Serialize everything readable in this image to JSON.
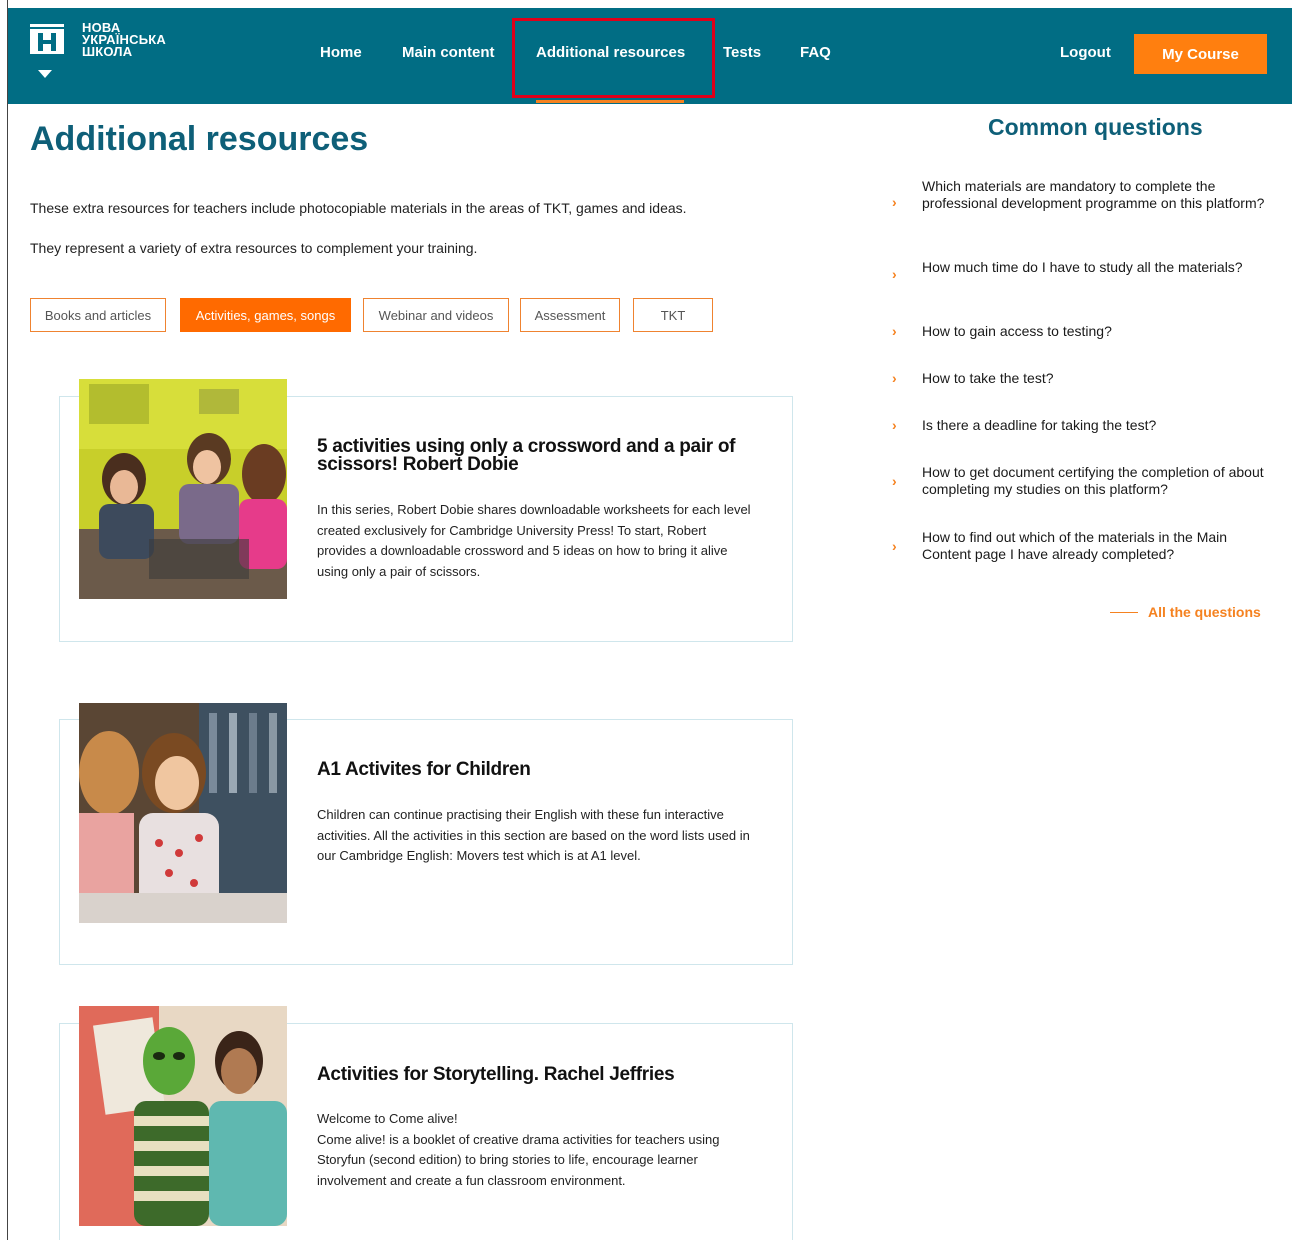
{
  "header": {
    "logo_lines": [
      "НОВА",
      "УКРАЇНСЬКА",
      "ШКОЛА"
    ],
    "nav": [
      "Home",
      "Main content",
      "Additional resources",
      "Tests",
      "FAQ"
    ],
    "active_nav": "Additional resources",
    "logout_label": "Logout",
    "my_course_label": "My Course"
  },
  "main": {
    "title": "Additional resources",
    "intro": [
      "These extra resources for teachers include photocopiable materials in the areas of TKT, games and ideas.",
      "They represent a variety of extra resources to complement your training."
    ],
    "filters": [
      "Books and articles",
      "Activities, games, songs",
      "Webinar and videos",
      "Assessment",
      "TKT"
    ],
    "active_filter": "Activities, games, songs",
    "cards": [
      {
        "title": "5 activities using only a crossword and a pair of scissors! Robert Dobie",
        "description": "In this series, Robert Dobie shares downloadable worksheets for each level created exclusively for Cambridge University Press! To start, Robert provides a downloadable crossword and 5 ideas on how to bring it alive using only a pair of scissors."
      },
      {
        "title": "A1 Activites for Children",
        "description": "Children can continue practising their English with these fun interactive activities. All the activities in this section are based on the word lists used in our Cambridge English: Movers test which is at A1 level."
      },
      {
        "title": "Activities for Storytelling. Rachel Jeffries",
        "description_lines": [
          "Welcome to Come alive!",
          "Come alive! is a booklet of creative drama activities for teachers using Storyfun (second edition) to bring stories to life, encourage learner involvement and create a fun classroom environment."
        ]
      }
    ]
  },
  "sidebar": {
    "title": "Common questions",
    "questions": [
      "Which materials are mandatory to complete the professional development programme on this platform?",
      "How much time do I have to study all the materials?",
      "How to gain access to testing?",
      "How to take the test?",
      "Is there a deadline for taking the test?",
      "How to get document certifying the completion of about completing my studies on this platform?",
      "How to find out which of the materials in the Main Content page I have already completed?"
    ],
    "all_questions_label": "All the questions"
  },
  "colors": {
    "header_bg": "#016d84",
    "accent": "#ff7f0f",
    "title": "#0e5f78",
    "highlight_outline": "#e0001a"
  }
}
